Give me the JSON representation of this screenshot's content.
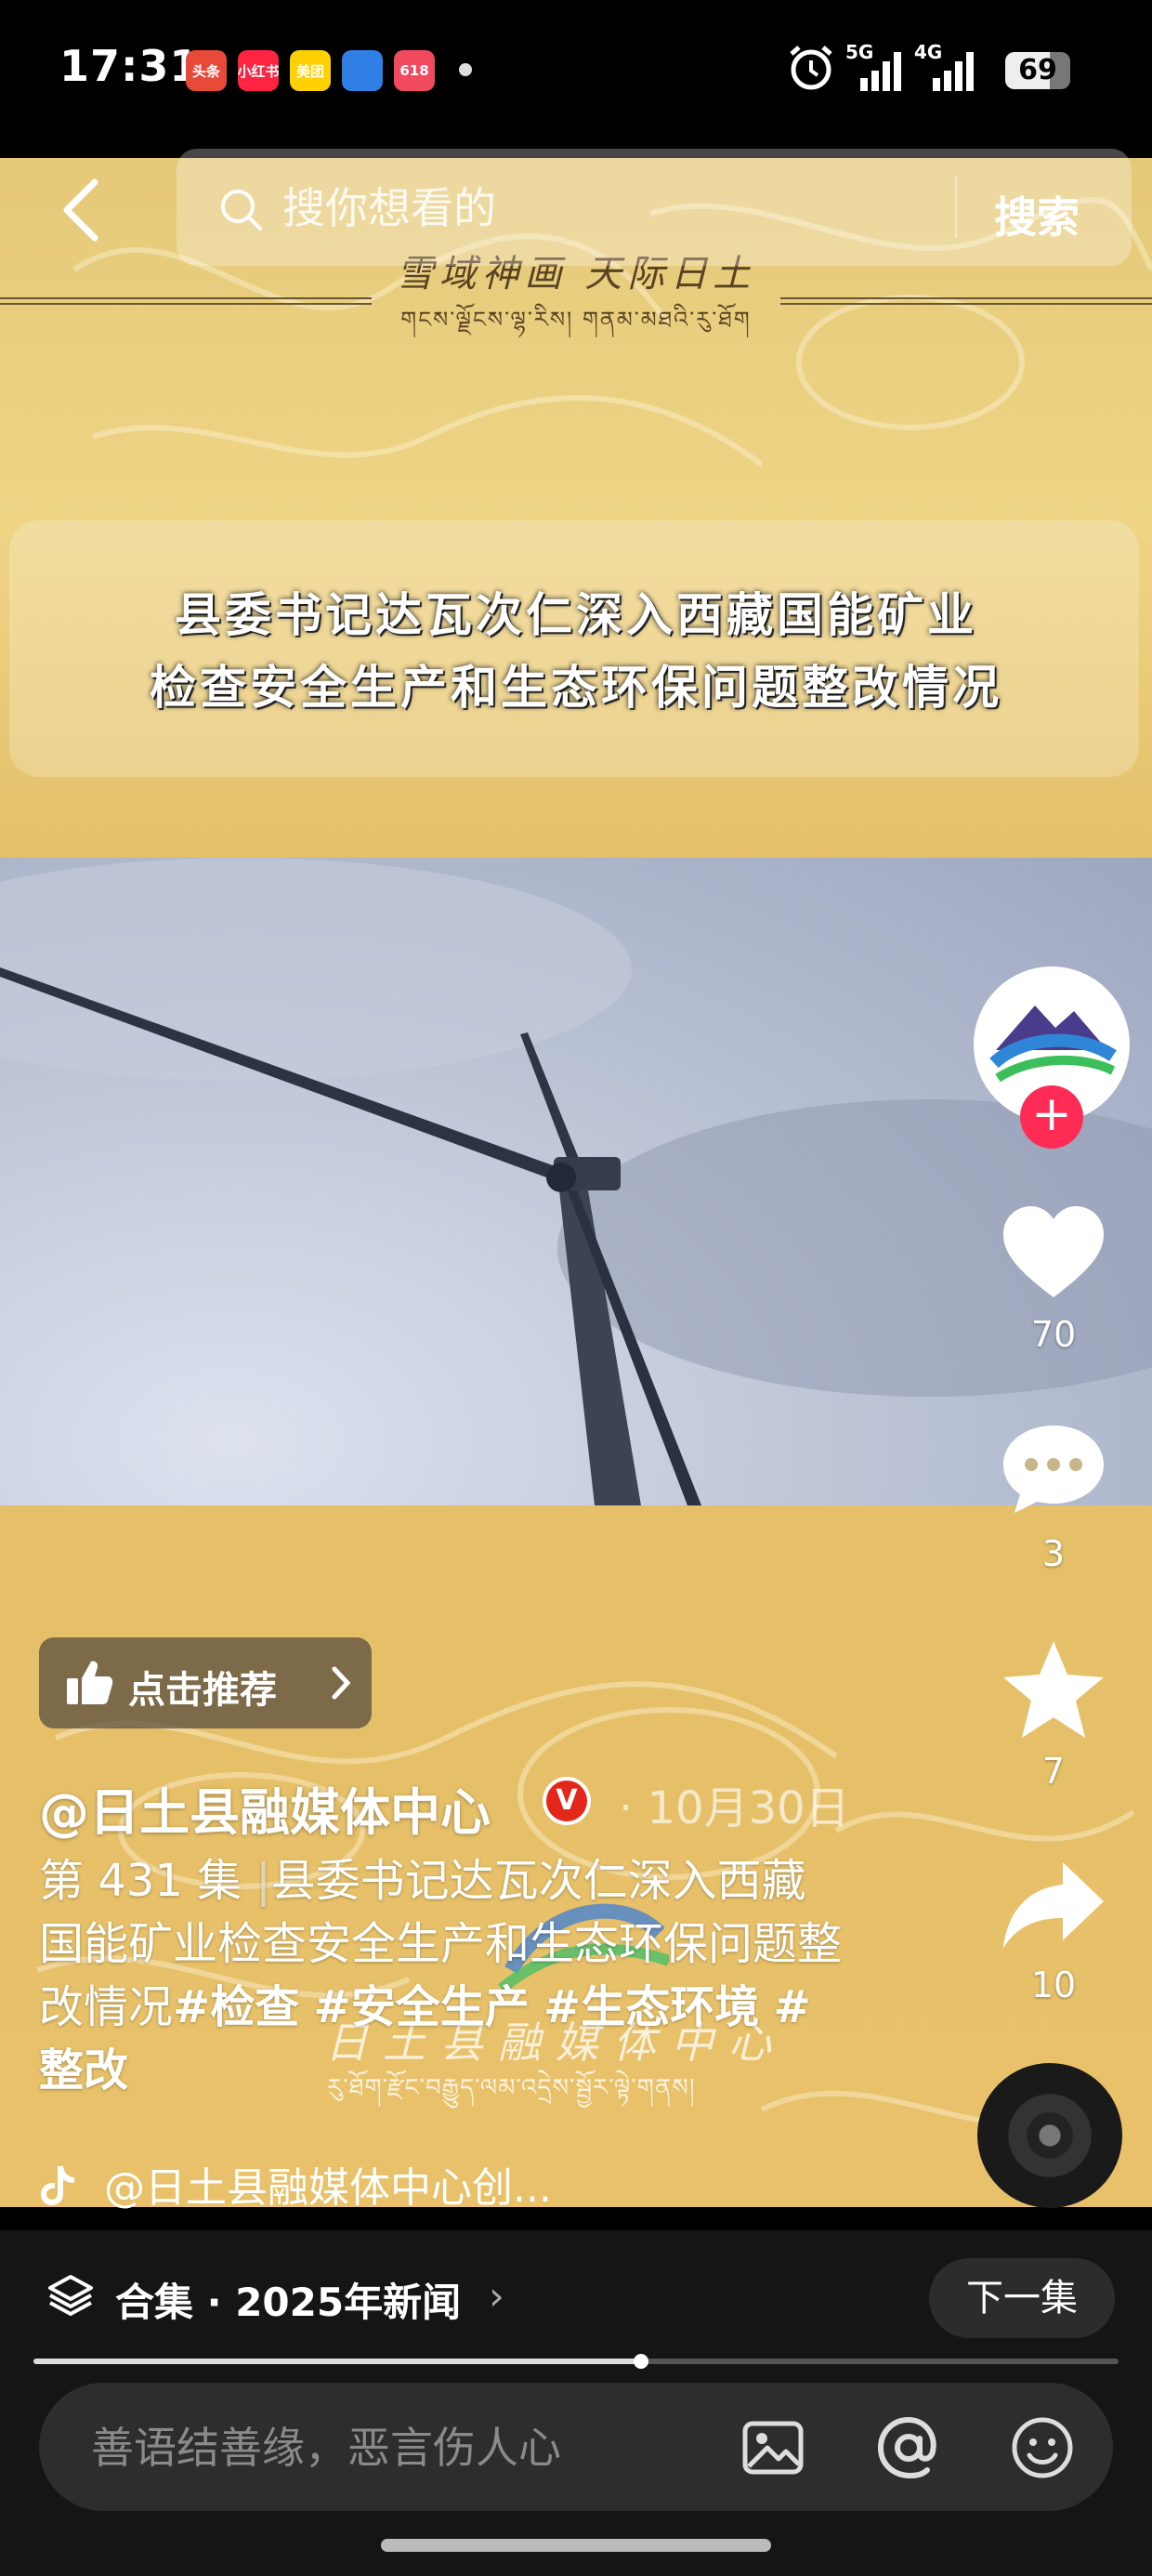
{
  "status_bar": {
    "time": "17:31",
    "apps": [
      {
        "name": "头条",
        "color": "#e84a3a"
      },
      {
        "name": "小红书",
        "color": "#ff2442"
      },
      {
        "name": "美团",
        "color": "#ffd100"
      },
      {
        "name": "app4",
        "color": "#2f7fe6"
      },
      {
        "name": "618",
        "color": "#f14a5e"
      }
    ],
    "network_1": "5G",
    "network_2": "4G",
    "battery": "69"
  },
  "search": {
    "placeholder": "搜你想看的",
    "button_label": "搜索"
  },
  "video": {
    "brand_slogan": "雪域神画 天际日土",
    "brand_slogan_tibetan": "གངས་ལྗོངས་ལྷ་རིས། གནམ་མཐའི་རུ་ཐོག",
    "headline_line1": "县委书记达瓦次仁深入西藏国能矿业",
    "headline_line2": "检查安全生产和生态环保问题整改情况",
    "watermark_name": "日土县融媒体中心",
    "watermark_tibetan": "རུ་ཐོག་རྫོང་བརྒྱུད་ལམ་འདྲེས་སྦྱོར་ལྟེ་གནས།"
  },
  "actions": {
    "likes": "70",
    "comments": "3",
    "favorites": "7",
    "shares": "10"
  },
  "post": {
    "recommend_label": "点击推荐",
    "author": "@日土县融媒体中心",
    "verified": "V",
    "date": "· 10月30日",
    "episode": "第 431 集",
    "separator": "|",
    "description": "县委书记达瓦次仁深入西藏国能矿业检查安全生产和生态环保问题整改情况",
    "hashtags": [
      "#检查",
      "#安全生产",
      "#生态环境",
      "#整改"
    ],
    "music": "@日土县融媒体中心创..."
  },
  "collection": {
    "label": "合集 · 2025年新闻",
    "next_label": "下一集"
  },
  "progress": 0.56,
  "comment": {
    "placeholder": "善语结善缘，恶言伤人心"
  }
}
